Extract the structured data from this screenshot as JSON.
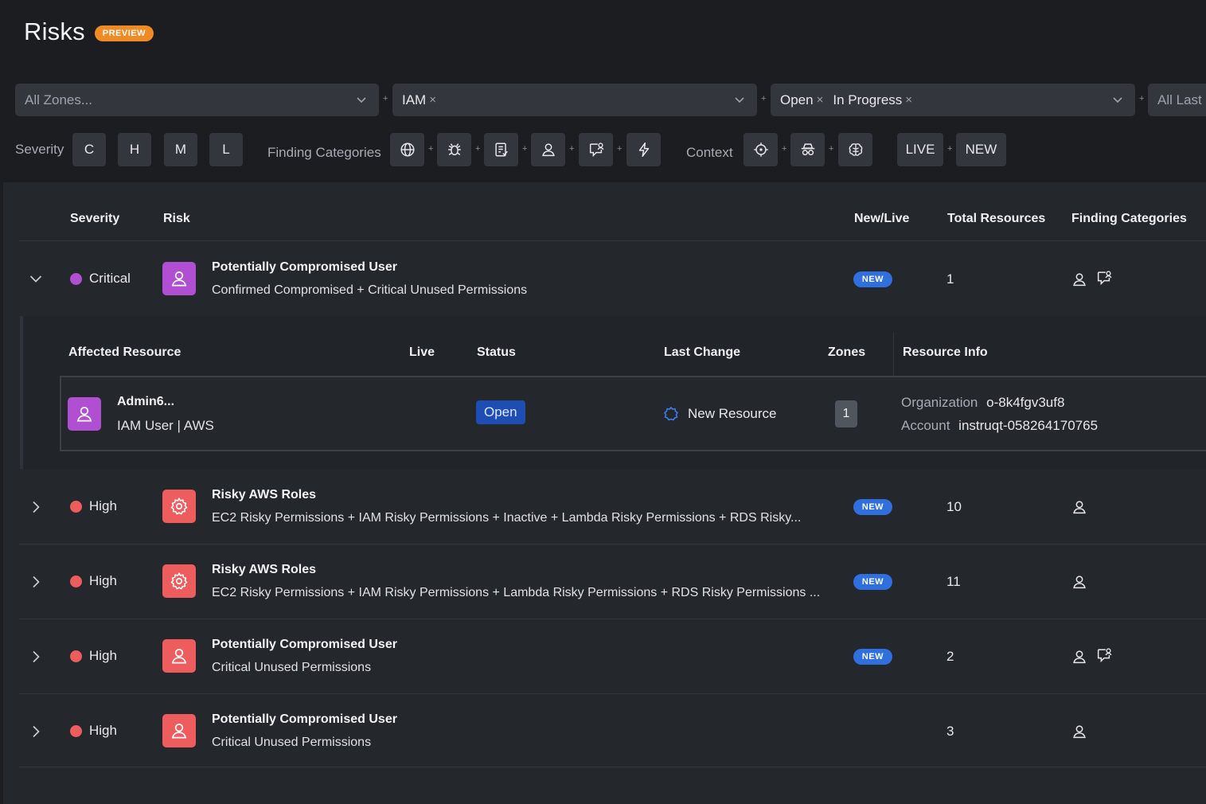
{
  "header": {
    "title": "Risks",
    "badge": "PREVIEW"
  },
  "filters": {
    "zones_placeholder": "All Zones...",
    "category_chip": "IAM",
    "status_chips": [
      "Open",
      "In Progress"
    ],
    "last_placeholder": "All Last C",
    "chip_remove": "×",
    "plus": "+"
  },
  "toolbar": {
    "severity_label": "Severity",
    "severity_buttons": [
      "C",
      "H",
      "M",
      "L"
    ],
    "finding_categories_label": "Finding Categories",
    "context_label": "Context",
    "live_label": "LIVE",
    "new_label": "NEW"
  },
  "table": {
    "headers": {
      "severity": "Severity",
      "risk": "Risk",
      "new_live": "New/Live",
      "total_resources": "Total Resources",
      "finding_categories": "Finding Categories"
    },
    "rows": [
      {
        "severity": "Critical",
        "severity_color": "#b04fd1",
        "icon_color": "#b04fd1",
        "icon": "user-icon",
        "title": "Potentially Compromised User",
        "description": "Confirmed Compromised + Critical Unused Permissions",
        "new_badge": "NEW",
        "total": "1",
        "categories": [
          "user-icon",
          "chat-user-icon"
        ],
        "expanded": true
      },
      {
        "severity": "High",
        "severity_color": "#ee5d5d",
        "icon_color": "#ee5d5d",
        "icon": "cog-icon",
        "title": "Risky AWS Roles",
        "description": "EC2 Risky Permissions + IAM Risky Permissions + Inactive + Lambda Risky Permissions + RDS Risky...",
        "new_badge": "NEW",
        "total": "10",
        "categories": [
          "user-icon"
        ]
      },
      {
        "severity": "High",
        "severity_color": "#ee5d5d",
        "icon_color": "#ee5d5d",
        "icon": "cog-icon",
        "title": "Risky AWS Roles",
        "description": "EC2 Risky Permissions + IAM Risky Permissions + Lambda Risky Permissions + RDS Risky Permissions ...",
        "new_badge": "NEW",
        "total": "11",
        "categories": [
          "user-icon"
        ]
      },
      {
        "severity": "High",
        "severity_color": "#ee5d5d",
        "icon_color": "#ee5d5d",
        "icon": "user-icon",
        "title": "Potentially Compromised User",
        "description": "Critical Unused Permissions",
        "new_badge": "NEW",
        "total": "2",
        "categories": [
          "user-icon",
          "chat-user-icon"
        ]
      },
      {
        "severity": "High",
        "severity_color": "#ee5d5d",
        "icon_color": "#ee5d5d",
        "icon": "user-icon",
        "title": "Potentially Compromised User",
        "description": "Critical Unused Permissions",
        "new_badge": "",
        "total": "3",
        "categories": [
          "user-icon"
        ]
      }
    ]
  },
  "detail": {
    "headers": {
      "affected_resource": "Affected Resource",
      "live": "Live",
      "status": "Status",
      "last_change": "Last Change",
      "zones": "Zones",
      "resource_info": "Resource Info"
    },
    "resource": {
      "name": "Admin6...",
      "type": "IAM User | AWS",
      "status": "Open",
      "last_change": "New Resource",
      "zones": "1",
      "org_label": "Organization",
      "org_value": "o-8k4fgv3uf8",
      "account_label": "Account",
      "account_value": "instruqt-058264170765"
    }
  }
}
